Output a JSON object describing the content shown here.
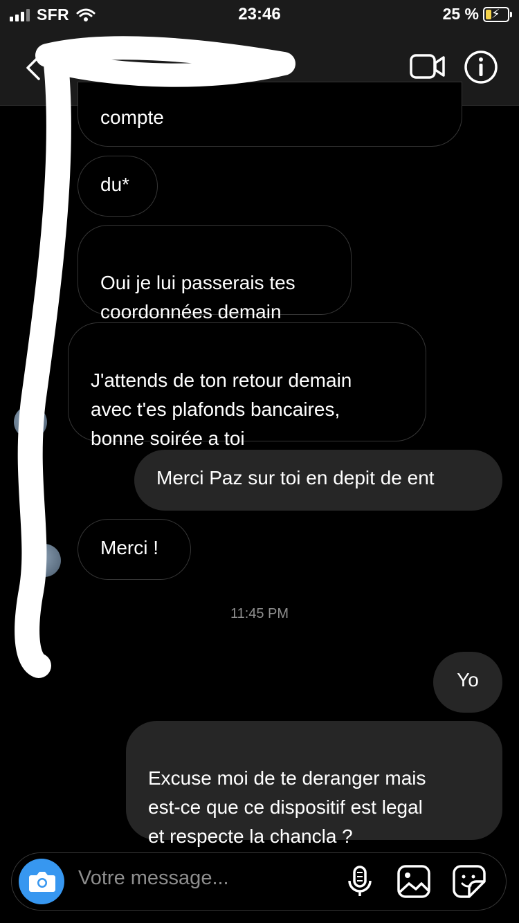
{
  "status_bar": {
    "carrier": "SFR",
    "time": "23:46",
    "battery_percent": "25 %",
    "battery_level": 0.25
  },
  "header": {
    "contact_name": "",
    "icons": [
      "back-chevron-icon",
      "video-call-icon",
      "info-icon"
    ]
  },
  "messages": [
    {
      "side": "received",
      "text": "compte"
    },
    {
      "side": "received",
      "text": "du*"
    },
    {
      "side": "received",
      "text": "Oui je lui passerais tes\ncoordonnées demain"
    },
    {
      "side": "received",
      "text": "J'attends de ton retour demain\navec t'es plafonds bancaires,\nbonne soirée a toi"
    },
    {
      "side": "sent",
      "text": "Merci Paz sur toi en depit de ent"
    },
    {
      "side": "received",
      "text": "Merci !"
    },
    {
      "side": "sent",
      "text": "Yo"
    },
    {
      "side": "sent",
      "text": "Excuse moi de te deranger mais\nest-ce que ce dispositif est legal\net respecte la chancla ?"
    }
  ],
  "timestamp": "11:45 PM",
  "composer": {
    "placeholder": "Votre message...",
    "icons": [
      "camera-icon",
      "microphone-icon",
      "gallery-icon",
      "sticker-icon"
    ]
  },
  "colors": {
    "background": "#000000",
    "sent_bubble": "#262626",
    "received_border": "#363636",
    "camera_button": "#3797f0",
    "muted_text": "#8e8e8e"
  }
}
